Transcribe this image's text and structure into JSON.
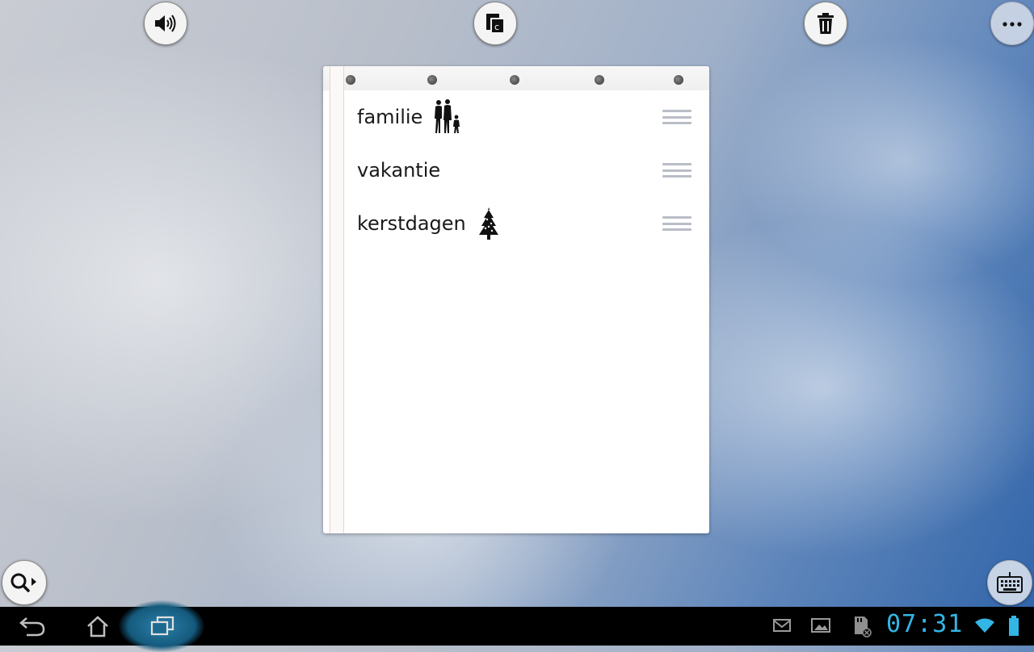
{
  "toolbar": {
    "sound_icon": "speaker-icon",
    "copy_icon": "copy-icon",
    "delete_icon": "trash-icon",
    "overflow_icon": "more-icon"
  },
  "notes": [
    {
      "title": "familie",
      "icon": "family-icon"
    },
    {
      "title": "vakantie",
      "icon": null
    },
    {
      "title": "kerstdagen",
      "icon": "christmas-tree-icon"
    }
  ],
  "bottom_buttons": {
    "search_icon": "search-icon",
    "keyboard_icon": "keyboard-icon"
  },
  "navbar": {
    "back_icon": "back-icon",
    "home_icon": "home-icon",
    "recent_icon": "recent-apps-icon"
  },
  "status_bar": {
    "time": "07:31",
    "icons": [
      "gmail-icon",
      "gallery-icon",
      "sdcard-icon",
      "wifi-icon",
      "battery-icon"
    ]
  },
  "colors": {
    "clock": "#33b5e5",
    "navbar": "#000000"
  }
}
